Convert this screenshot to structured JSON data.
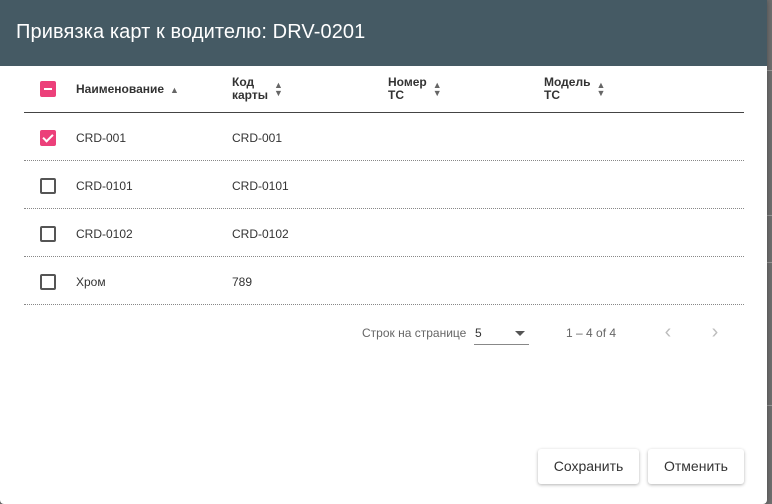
{
  "dialog": {
    "title": "Привязка карт к водителю: DRV-0201"
  },
  "table": {
    "columns": [
      {
        "label": "Наименование",
        "sort": "asc"
      },
      {
        "label": "Код\nкарты",
        "sort": "none"
      },
      {
        "label": "Номер\nТС",
        "sort": "none"
      },
      {
        "label": "Модель\nТС",
        "sort": "none"
      }
    ],
    "select_all_state": "indeterminate",
    "rows": [
      {
        "name": "CRD-001",
        "code": "CRD-001",
        "vehicle_number": "",
        "vehicle_model": "",
        "checked": true
      },
      {
        "name": "CRD-0101",
        "code": "CRD-0101",
        "vehicle_number": "",
        "vehicle_model": "",
        "checked": false
      },
      {
        "name": "CRD-0102",
        "code": "CRD-0102",
        "vehicle_number": "",
        "vehicle_model": "",
        "checked": false
      },
      {
        "name": "Хром",
        "code": "789",
        "vehicle_number": "",
        "vehicle_model": "",
        "checked": false
      }
    ]
  },
  "pagination": {
    "rows_per_page_label": "Строк на странице",
    "rows_per_page_value": "5",
    "range_text": "1 – 4 of 4",
    "prev_icon": "chevron-left-icon",
    "next_icon": "chevron-right-icon"
  },
  "actions": {
    "save_label": "Сохранить",
    "cancel_label": "Отменить"
  },
  "colors": {
    "header_bg": "#455a64",
    "accent": "#ec407a"
  }
}
